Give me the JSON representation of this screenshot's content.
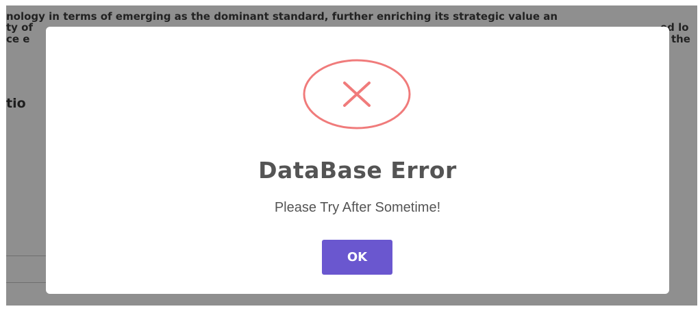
{
  "background": {
    "lines": [
      "nology in terms of emerging as the dominant standard, further enriching its strategic value an",
      "ty of",
      "ce e"
    ],
    "right_fragments": [
      "ed lo",
      "d the"
    ],
    "heading_fragment": "tio"
  },
  "dialog": {
    "icon": "error-x-circle-icon",
    "icon_color": "#f07b7b",
    "title": "DataBase Error",
    "message": "Please Try After Sometime!",
    "ok_label": "OK",
    "accent_color": "#6a57cf"
  }
}
